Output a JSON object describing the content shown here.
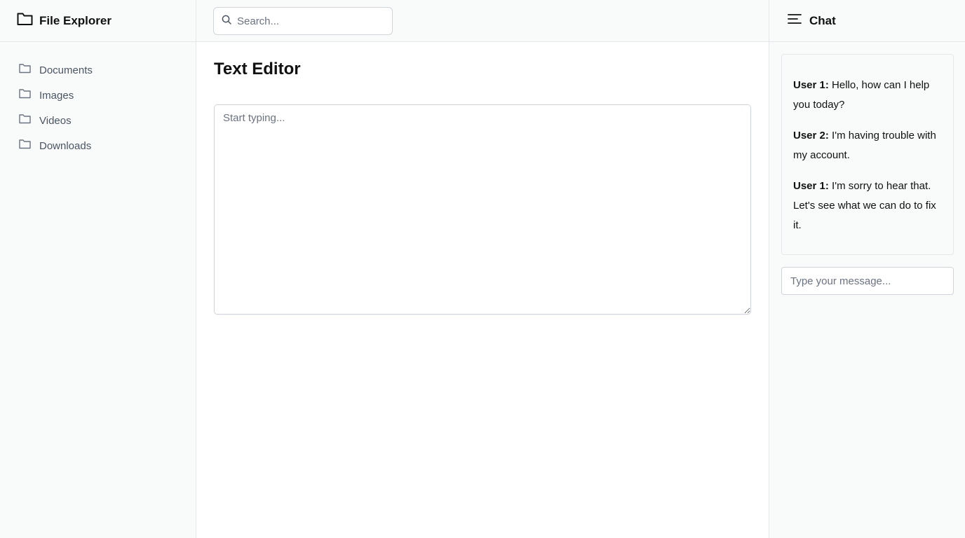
{
  "left_sidebar": {
    "title": "File Explorer",
    "title_icon": "folder-icon",
    "folders": [
      {
        "label": "Documents",
        "icon": "folder-icon"
      },
      {
        "label": "Images",
        "icon": "folder-icon"
      },
      {
        "label": "Videos",
        "icon": "folder-icon"
      },
      {
        "label": "Downloads",
        "icon": "folder-icon"
      }
    ]
  },
  "search": {
    "placeholder": "Search...",
    "value": "",
    "icon": "search-icon"
  },
  "editor": {
    "title": "Text Editor",
    "placeholder": "Start typing...",
    "value": ""
  },
  "chat": {
    "title": "Chat",
    "title_icon": "menu-icon",
    "messages": [
      {
        "sender": "User 1:",
        "text": "Hello, how can I help you today?"
      },
      {
        "sender": "User 2:",
        "text": "I'm having trouble with my account."
      },
      {
        "sender": "User 1:",
        "text": "I'm sorry to hear that. Let's see what we can do to fix it."
      }
    ],
    "input_placeholder": "Type your message...",
    "input_value": ""
  },
  "colors": {
    "panel_bg": "#f9fafa",
    "border": "#e5e7eb",
    "muted_text": "#4b5563",
    "text": "#111827"
  }
}
